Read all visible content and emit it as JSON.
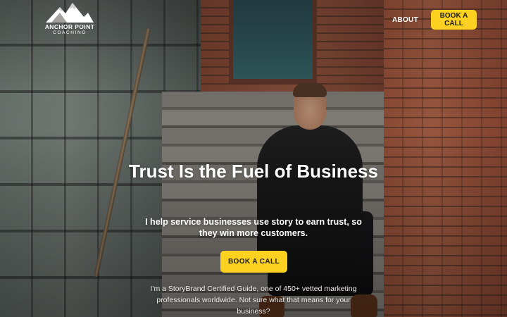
{
  "header": {
    "logo": {
      "icon": "mountain-peaks-icon",
      "name": "ANCHOR POINT",
      "sub": "COACHING"
    },
    "nav": {
      "about_label": "ABOUT",
      "book_label": "BOOK A CALL"
    }
  },
  "hero": {
    "headline": "Trust Is the Fuel of Business",
    "subhead": "I help service businesses use story to earn trust, so they win more customers.",
    "cta_label": "BOOK A CALL",
    "blurb": "I'm a StoryBrand Certified Guide, one of 450+ vetted marketing professionals worldwide. Not sure what that means for your business?"
  },
  "colors": {
    "accent": "#fcd11f",
    "text_light": "#ffffff",
    "button_text": "#1b1b1b"
  }
}
